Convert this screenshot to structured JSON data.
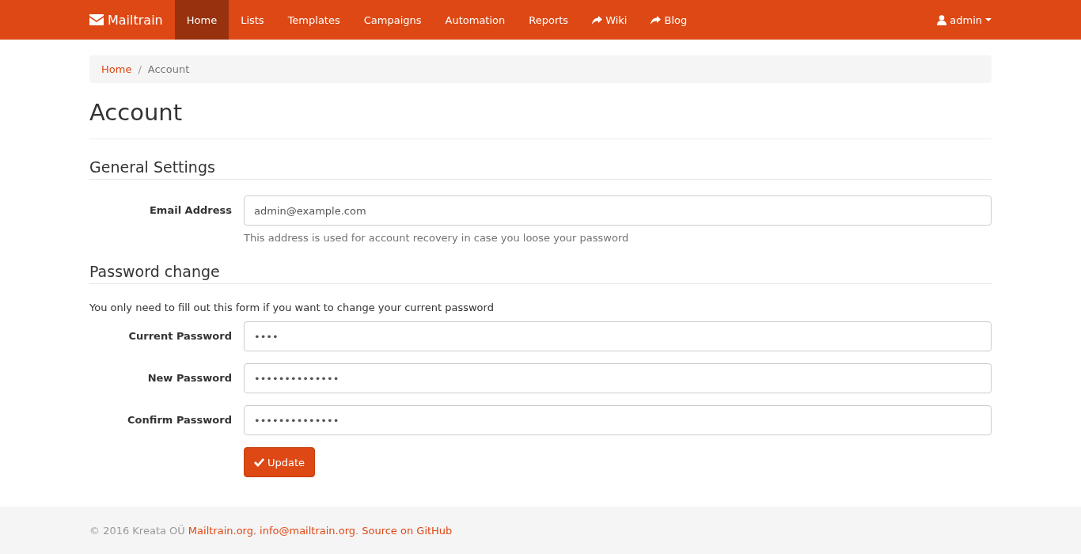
{
  "navbar": {
    "brand": "Mailtrain",
    "items": [
      {
        "label": "Home",
        "selected": true,
        "kind": "internal"
      },
      {
        "label": "Lists",
        "selected": false,
        "kind": "internal"
      },
      {
        "label": "Templates",
        "selected": false,
        "kind": "internal"
      },
      {
        "label": "Campaigns",
        "selected": false,
        "kind": "internal"
      },
      {
        "label": "Automation",
        "selected": false,
        "kind": "internal"
      },
      {
        "label": "Reports",
        "selected": false,
        "kind": "internal"
      },
      {
        "label": "Wiki",
        "selected": false,
        "kind": "external"
      },
      {
        "label": "Blog",
        "selected": false,
        "kind": "external"
      }
    ],
    "user": "admin"
  },
  "breadcrumb_separator": "/",
  "breadcrumb": [
    {
      "label": "Home",
      "kind": "link"
    },
    {
      "label": "Account",
      "kind": "current"
    }
  ],
  "title": "Account",
  "sections": [
    {
      "heading": "General Settings",
      "fields": [
        {
          "label": "Email Address",
          "value": "admin@example.com",
          "help": "This address is used for account recovery in case you loose your password"
        }
      ]
    },
    {
      "heading": "Password change",
      "intro": "You only need to fill out this form if you want to change your current password",
      "fields": [
        {
          "label": "Current Password",
          "value": "••••"
        },
        {
          "label": "New Password",
          "value": "••••••••••••••"
        },
        {
          "label": "Confirm Password",
          "value": "••••••••••••••"
        }
      ]
    }
  ],
  "submit": "Update",
  "footer": {
    "copyright": "© 2016 Kreata OÜ",
    "links": [
      {
        "label": "Mailtrain.org",
        "after": ","
      },
      {
        "label": "info@mailtrain.org",
        "after": "."
      },
      {
        "label": "Source on GitHub"
      }
    ]
  }
}
